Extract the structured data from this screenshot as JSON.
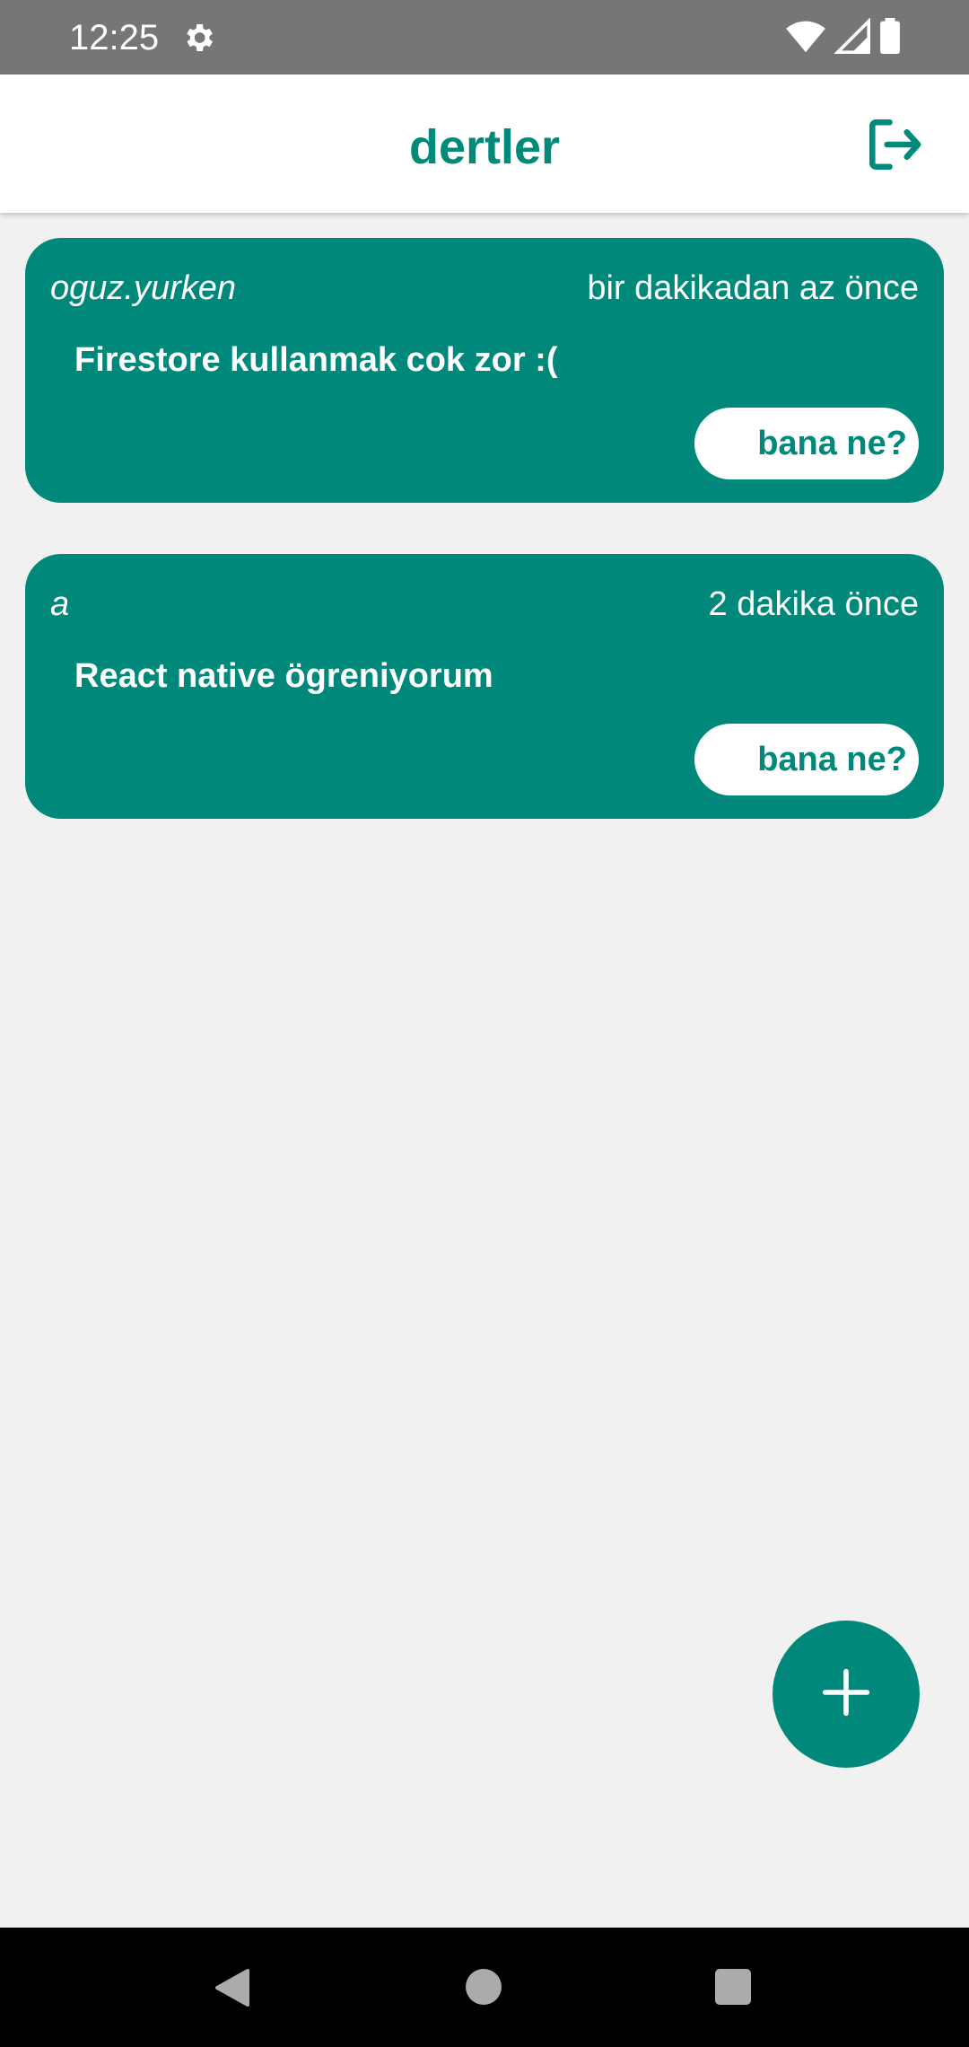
{
  "status_bar": {
    "time": "12:25",
    "icons": [
      "gear-icon",
      "wifi-icon",
      "cell-signal-icon",
      "battery-icon"
    ]
  },
  "app_bar": {
    "title": "dertler",
    "action_icon": "logout-icon"
  },
  "posts": [
    {
      "author": "oguz.yurken",
      "time": "bir dakikadan az önce",
      "text": "Firestore kullanmak cok zor :(",
      "button_label": "bana ne?"
    },
    {
      "author": "a",
      "time": "2 dakika önce",
      "text": "React native ögreniyorum",
      "button_label": "bana ne?"
    }
  ],
  "fab": {
    "icon": "plus-icon"
  },
  "nav_bar": {
    "icons": [
      "back-icon",
      "home-icon",
      "recents-icon"
    ]
  },
  "colors": {
    "accent": "#00897b",
    "title": "#008a7a",
    "background": "#f1f1f1",
    "status_bar": "#767676",
    "nav_bar": "#000000"
  }
}
